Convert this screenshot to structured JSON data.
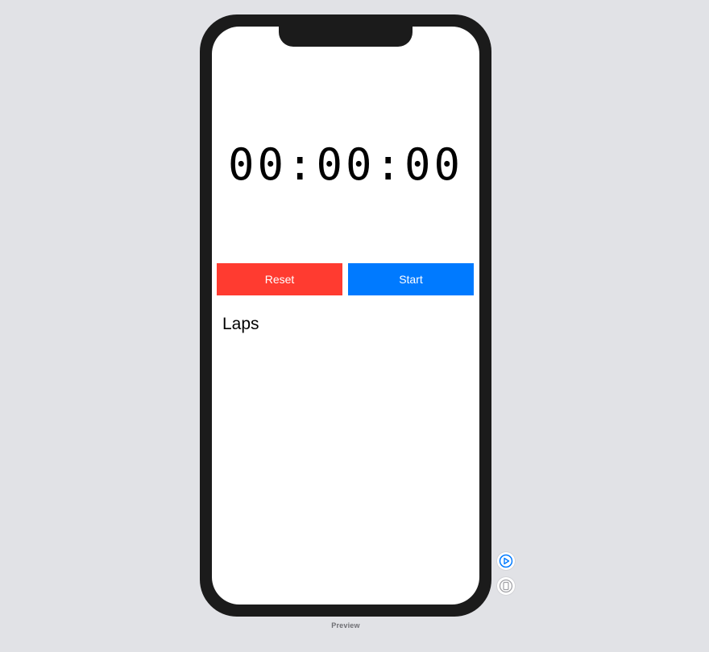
{
  "stopwatch": {
    "time_display": "00:00:00",
    "reset_label": "Reset",
    "start_label": "Start",
    "laps_title": "Laps"
  },
  "preview": {
    "label": "Preview",
    "controls": {
      "live_icon": "play-circle-icon",
      "device_icon": "device-icon"
    }
  },
  "colors": {
    "reset": "#ff3b30",
    "start": "#007aff",
    "frame": "#1b1b1b",
    "background": "#e1e2e6"
  }
}
